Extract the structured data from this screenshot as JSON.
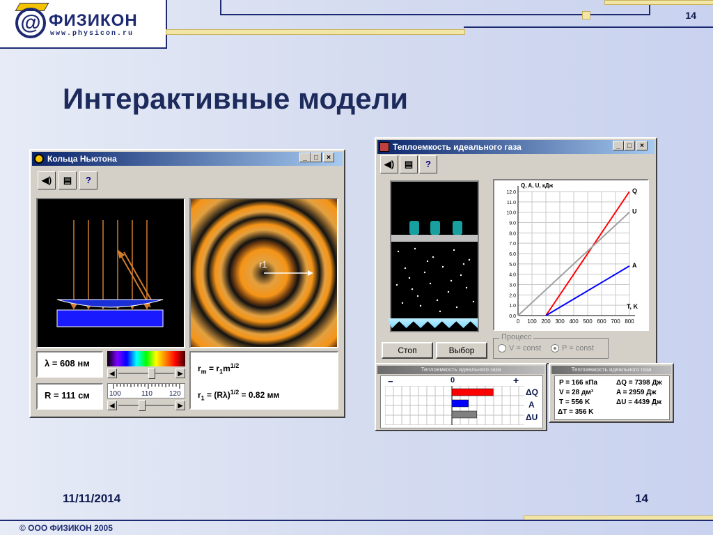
{
  "header": {
    "logo_name": "ФИЗИКОН",
    "logo_url": "www.physicon.ru",
    "page_number": "14"
  },
  "slide": {
    "title": "Интерактивные модели",
    "date": "11/11/2014",
    "page": "14",
    "copyright": "© ООО ФИЗИКОН 2005"
  },
  "newton": {
    "title": "Кольца Ньютона",
    "lambda": "λ = 608 нм",
    "radius": "R = 111 см",
    "scale": [
      "100",
      "110",
      "120"
    ],
    "formula1": "rm = r1m1/2",
    "formula2": "r1 = (Rλ)1/2 = 0.82 мм",
    "ring_label": "r1",
    "f1a": "r",
    "f1b": "m",
    "f1c": " = r",
    "f1d": "1",
    "f1e": "m",
    "f1f": "1/2",
    "f2a": "r",
    "f2b": "1",
    "f2c": " = (Rλ)",
    "f2d": "1/2",
    "f2e": " = 0.82 мм",
    "lambda_slider": 0.6,
    "r_slider": 0.4
  },
  "gas": {
    "title": "Теплоемкость идеального газа",
    "btn_stop": "Стоп",
    "btn_choose": "Выбор",
    "process_label": "Процесс",
    "radio_v": "V = const",
    "radio_p": "P = const",
    "selected": "P = const",
    "chart_ylabel": "Q, A, U, кДж",
    "chart_xlabel": "T, K",
    "series_q": "Q",
    "series_u": "U",
    "series_a": "A"
  },
  "chart_data": {
    "type": "line",
    "xlabel": "T, K",
    "ylabel": "Q, A, U, кДж",
    "xlim": [
      0,
      800
    ],
    "ylim": [
      0,
      12
    ],
    "x_ticks": [
      0,
      100,
      200,
      300,
      400,
      500,
      600,
      700,
      800
    ],
    "y_ticks": [
      "0.0",
      "1.0",
      "2.0",
      "3.0",
      "4.0",
      "5.0",
      "6.0",
      "7.0",
      "8.0",
      "9.0",
      "10.0",
      "11.0",
      "12.0"
    ],
    "grid": true,
    "series": [
      {
        "name": "Q",
        "color": "#ff0000",
        "x": [
          200,
          800
        ],
        "y": [
          0,
          12.0
        ]
      },
      {
        "name": "U",
        "color": "#a0a0a0",
        "x": [
          0,
          800
        ],
        "y": [
          0,
          10.0
        ]
      },
      {
        "name": "A",
        "color": "#0000ff",
        "x": [
          200,
          800
        ],
        "y": [
          0,
          4.8
        ]
      }
    ]
  },
  "energy_panel": {
    "title": "Теплоемкость идеального газа",
    "minus": "−",
    "zero": "0",
    "plus": "+",
    "labels": [
      "ΔQ",
      "A",
      "ΔU"
    ],
    "bars": [
      {
        "name": "ΔQ",
        "value": 7398,
        "color": "#ff0000"
      },
      {
        "name": "A",
        "value": 2959,
        "color": "#0000ff"
      },
      {
        "name": "ΔU",
        "value": 4439,
        "color": "#808080"
      }
    ]
  },
  "readout": {
    "title": "Теплоемкость идеального газа",
    "rows": [
      [
        "P  = 166 кПа",
        "ΔQ = 7398 Дж"
      ],
      [
        "V  =  28 дм³",
        "A  = 2959 Дж"
      ],
      [
        "T  = 556 K",
        "ΔU = 4439 Дж"
      ],
      [
        "ΔT = 356 K",
        ""
      ]
    ]
  }
}
